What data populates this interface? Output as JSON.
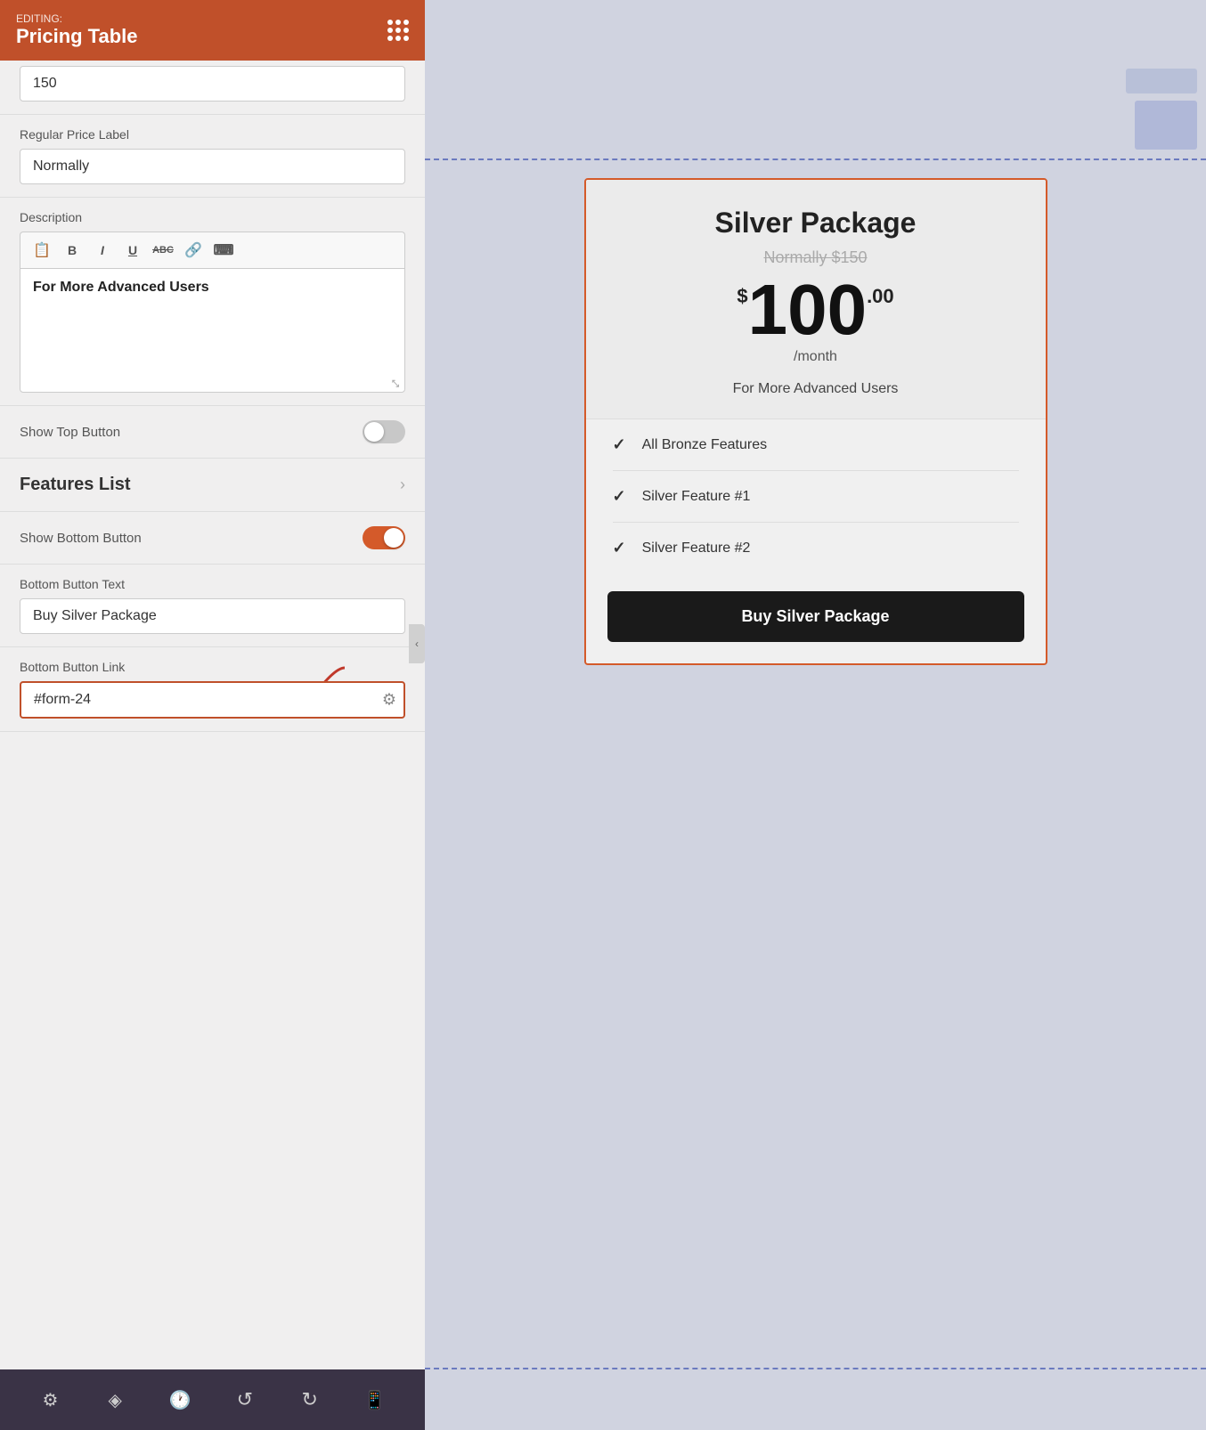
{
  "header": {
    "editing_label": "EDITING:",
    "title": "Pricing Table"
  },
  "panel": {
    "first_input_value": "150",
    "regular_price_label": "Regular Price Label",
    "regular_price_value": "Normally",
    "description_label": "Description",
    "description_content": "For More Advanced Users",
    "toolbar_buttons": [
      {
        "label": "📋",
        "name": "clipboard-icon"
      },
      {
        "label": "B",
        "name": "bold-icon"
      },
      {
        "label": "I",
        "name": "italic-icon"
      },
      {
        "label": "U",
        "name": "underline-icon"
      },
      {
        "label": "ABC",
        "name": "strikethrough-icon"
      },
      {
        "label": "🔗",
        "name": "link-icon"
      },
      {
        "label": "⌨",
        "name": "keyboard-icon"
      }
    ],
    "show_top_button_label": "Show Top Button",
    "show_top_button_on": false,
    "features_list_label": "Features List",
    "show_bottom_button_label": "Show Bottom Button",
    "show_bottom_button_on": true,
    "bottom_button_text_label": "Bottom Button Text",
    "bottom_button_text_value": "Buy Silver Package",
    "bottom_button_link_label": "Bottom Button Link",
    "bottom_button_link_value": "#form-24"
  },
  "bottom_toolbar": {
    "icons": [
      {
        "label": "⚙",
        "name": "settings-icon"
      },
      {
        "label": "◈",
        "name": "layers-icon"
      },
      {
        "label": "🕐",
        "name": "history-icon"
      },
      {
        "label": "↺",
        "name": "undo-icon"
      },
      {
        "label": "↻",
        "name": "redo-icon"
      },
      {
        "label": "📱",
        "name": "mobile-icon"
      }
    ]
  },
  "pricing_card": {
    "title": "Silver Package",
    "original_price": "Normally $150",
    "price_dollar_sign": "$",
    "price_main": "100",
    "price_cents": ".00",
    "price_period": "/month",
    "description": "For More Advanced Users",
    "features": [
      {
        "text": "All Bronze Features"
      },
      {
        "text": "Silver Feature #1"
      },
      {
        "text": "Silver Feature #2"
      }
    ],
    "buy_button_text": "Buy Silver Package"
  },
  "colors": {
    "header_bg": "#c0502a",
    "toggle_on": "#d45a2a",
    "card_border": "#d45a2a",
    "bottom_toolbar_bg": "#3a3346"
  }
}
